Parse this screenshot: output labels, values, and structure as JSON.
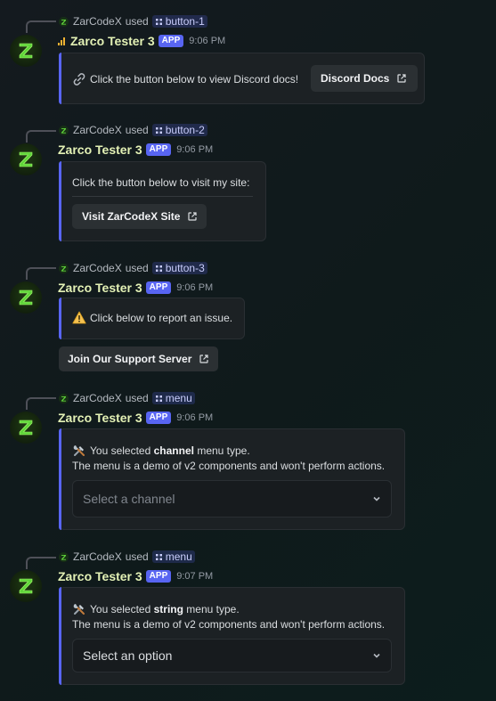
{
  "messages": [
    {
      "replied_user": "ZarCodeX",
      "used": "used",
      "command": "button-1",
      "author": "Zarco Tester 3",
      "badge": "APP",
      "time": "9:06 PM",
      "text": "Click the button below to view Discord docs!",
      "button": "Discord Docs"
    },
    {
      "replied_user": "ZarCodeX",
      "used": "used",
      "command": "button-2",
      "author": "Zarco Tester 3",
      "badge": "APP",
      "time": "9:06 PM",
      "text": "Click the button below to visit my site:",
      "button": "Visit ZarCodeX Site"
    },
    {
      "replied_user": "ZarCodeX",
      "used": "used",
      "command": "button-3",
      "author": "Zarco Tester 3",
      "badge": "APP",
      "time": "9:06 PM",
      "text": "Click below to report an issue.",
      "button": "Join Our Support Server"
    },
    {
      "replied_user": "ZarCodeX",
      "used": "used",
      "command": "menu",
      "author": "Zarco Tester 3",
      "badge": "APP",
      "time": "9:06 PM",
      "line1_pre": "You selected ",
      "line1_bold": "channel",
      "line1_post": " menu type.",
      "line2": "The menu is a demo of v2 components and won't perform actions.",
      "select_placeholder": "Select a channel"
    },
    {
      "replied_user": "ZarCodeX",
      "used": "used",
      "command": "menu",
      "author": "Zarco Tester 3",
      "badge": "APP",
      "time": "9:07 PM",
      "line1_pre": "You selected ",
      "line1_bold": "string",
      "line1_post": " menu type.",
      "line2": "The menu is a demo of v2 components and won't perform actions.",
      "select_placeholder": "Select an option"
    }
  ],
  "colors": {
    "accent_bar": "#5865f2",
    "app_badge": "#5865f2",
    "username": "#e3f1b5"
  },
  "icons": {
    "avatar": "zarco-z-logo-icon",
    "command": "app-command-grid-icon",
    "external": "external-link-icon",
    "link": "link-icon",
    "warning": "warning-icon",
    "tools": "hammer-wrench-icon",
    "chevron": "chevron-down-icon",
    "signal": "connection-signal-icon"
  }
}
